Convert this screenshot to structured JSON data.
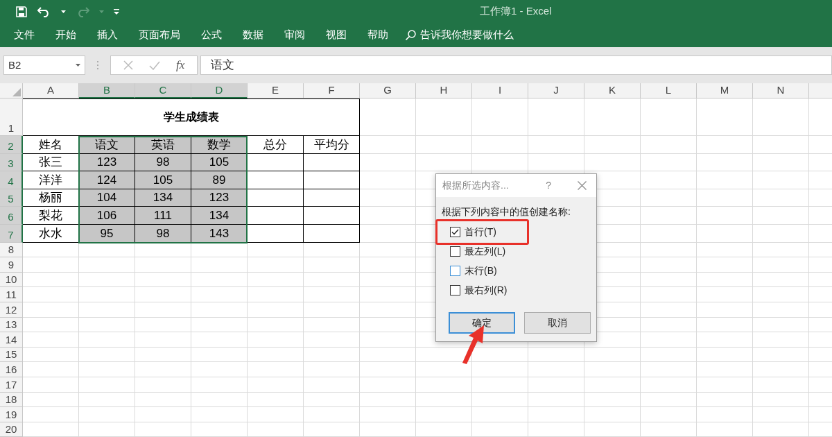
{
  "window": {
    "title": "工作簿1 - Excel"
  },
  "ribbon_tabs": [
    {
      "label": "文件"
    },
    {
      "label": "开始"
    },
    {
      "label": "插入"
    },
    {
      "label": "页面布局"
    },
    {
      "label": "公式"
    },
    {
      "label": "数据"
    },
    {
      "label": "审阅"
    },
    {
      "label": "视图"
    },
    {
      "label": "帮助"
    }
  ],
  "tell_me": {
    "placeholder": "告诉我你想要做什么"
  },
  "formula_bar": {
    "name_box": "B2",
    "fx": "fx",
    "value": "语文"
  },
  "columns": [
    {
      "label": "A",
      "selected": false
    },
    {
      "label": "B",
      "selected": true
    },
    {
      "label": "C",
      "selected": true
    },
    {
      "label": "D",
      "selected": true
    },
    {
      "label": "E",
      "selected": false
    },
    {
      "label": "F",
      "selected": false
    },
    {
      "label": "G",
      "selected": false
    },
    {
      "label": "H",
      "selected": false
    },
    {
      "label": "I",
      "selected": false
    },
    {
      "label": "J",
      "selected": false
    },
    {
      "label": "K",
      "selected": false
    },
    {
      "label": "L",
      "selected": false
    },
    {
      "label": "M",
      "selected": false
    },
    {
      "label": "N",
      "selected": false
    }
  ],
  "rows": [
    {
      "number": "1",
      "selected": false,
      "kind": "title",
      "title": "学生成绩表"
    },
    {
      "number": "2",
      "selected": true,
      "kind": "table",
      "cells": [
        "姓名",
        "语文",
        "英语",
        "数学",
        "总分",
        "平均分"
      ]
    },
    {
      "number": "3",
      "selected": true,
      "kind": "table",
      "cells": [
        "张三",
        "123",
        "98",
        "105"
      ]
    },
    {
      "number": "4",
      "selected": true,
      "kind": "table",
      "cells": [
        "洋洋",
        "124",
        "105",
        "89"
      ]
    },
    {
      "number": "5",
      "selected": true,
      "kind": "table",
      "cells": [
        "杨丽",
        "104",
        "134",
        "123"
      ]
    },
    {
      "number": "6",
      "selected": true,
      "kind": "table",
      "cells": [
        "梨花",
        "106",
        "111",
        "134"
      ]
    },
    {
      "number": "7",
      "selected": true,
      "kind": "table",
      "cells": [
        "水水",
        "95",
        "98",
        "143"
      ]
    },
    {
      "number": "8",
      "selected": false,
      "kind": "empty"
    },
    {
      "number": "9",
      "selected": false,
      "kind": "empty"
    },
    {
      "number": "10",
      "selected": false,
      "kind": "empty"
    },
    {
      "number": "11",
      "selected": false,
      "kind": "empty"
    },
    {
      "number": "12",
      "selected": false,
      "kind": "empty"
    },
    {
      "number": "13",
      "selected": false,
      "kind": "empty"
    },
    {
      "number": "14",
      "selected": false,
      "kind": "empty"
    },
    {
      "number": "15",
      "selected": false,
      "kind": "empty"
    },
    {
      "number": "16",
      "selected": false,
      "kind": "empty"
    },
    {
      "number": "17",
      "selected": false,
      "kind": "empty"
    },
    {
      "number": "18",
      "selected": false,
      "kind": "empty"
    },
    {
      "number": "19",
      "selected": false,
      "kind": "empty"
    },
    {
      "number": "20",
      "selected": false,
      "kind": "empty"
    }
  ],
  "dialog": {
    "title": "根据所选内容...",
    "help": "?",
    "prompt": "根据下列内容中的值创建名称:",
    "options": [
      {
        "label": "首行(T)",
        "checked": true,
        "hovered": false
      },
      {
        "label": "最左列(L)",
        "checked": false,
        "hovered": false
      },
      {
        "label": "末行(B)",
        "checked": false,
        "hovered": true
      },
      {
        "label": "最右列(R)",
        "checked": false,
        "hovered": false
      }
    ],
    "buttons": [
      {
        "label": "确定",
        "default": true
      },
      {
        "label": "取消",
        "default": false
      }
    ]
  }
}
